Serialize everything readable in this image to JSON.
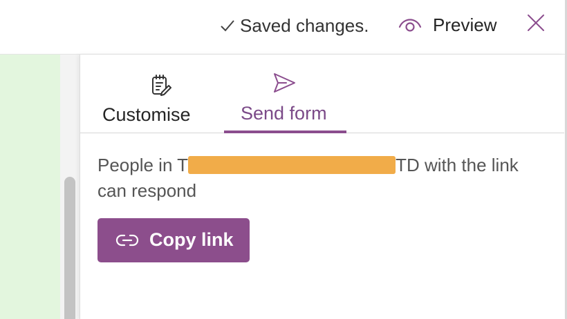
{
  "header": {
    "saved_status": "Saved changes.",
    "preview_label": "Preview",
    "close_icon": "close-icon"
  },
  "panel": {
    "tabs": [
      {
        "label": "Customise",
        "icon": "edit-document-icon",
        "active": false
      },
      {
        "label": "Send form",
        "icon": "send-icon",
        "active": true
      }
    ],
    "sharing_text_before": "People in T",
    "sharing_text_after": "TD with the link can respond",
    "copy_link_label": "Copy link"
  },
  "colors": {
    "accent": "#8c4e8c",
    "active_tab_text": "#7b4a88",
    "background_form": "#e3f6de",
    "redaction": "#f0a53a"
  }
}
